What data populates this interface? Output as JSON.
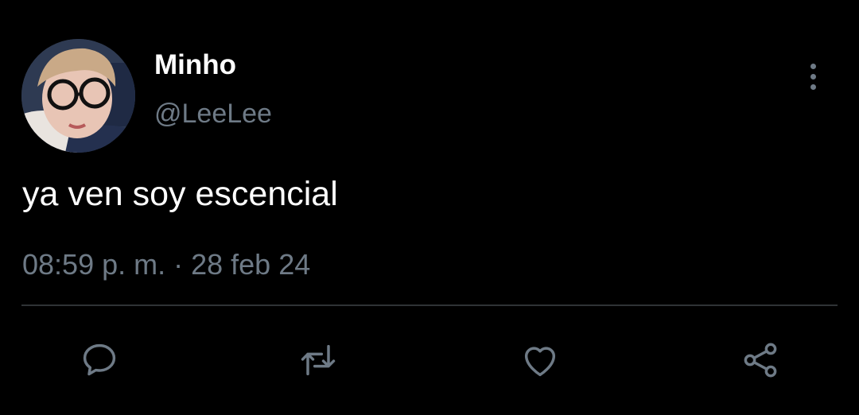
{
  "tweet": {
    "author": {
      "display_name": "Minho",
      "handle": "@LeeLee"
    },
    "text": "ya ven soy escencial",
    "timestamp": "08:59 p. m. · 28 feb 24"
  },
  "actions": {
    "reply_icon": "reply-icon",
    "retweet_icon": "retweet-icon",
    "like_icon": "heart-icon",
    "share_icon": "share-icon"
  },
  "colors": {
    "background": "#000000",
    "primary_text": "#ffffff",
    "secondary_text": "#6e7a86",
    "divider": "#2f3336"
  }
}
